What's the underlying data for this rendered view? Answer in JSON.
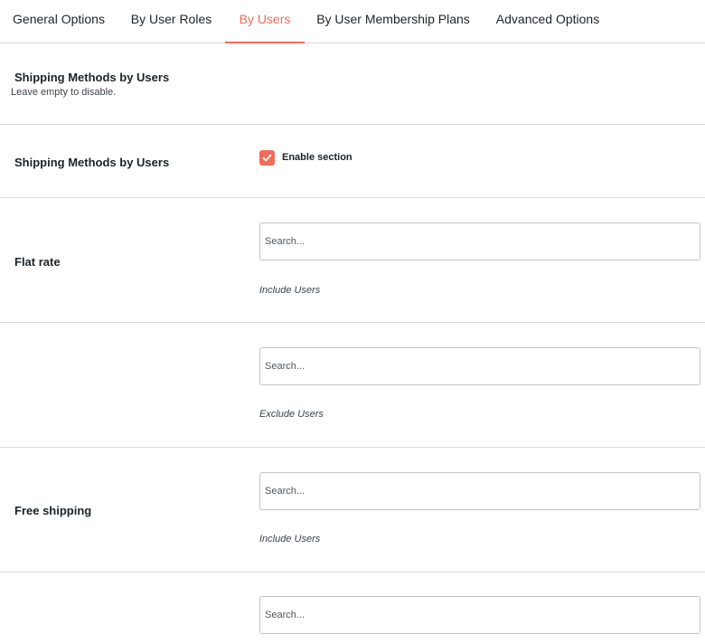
{
  "tabs": [
    {
      "label": "General Options",
      "active": false
    },
    {
      "label": "By User Roles",
      "active": false
    },
    {
      "label": "By Users",
      "active": true
    },
    {
      "label": "By User Membership Plans",
      "active": false
    },
    {
      "label": "Advanced Options",
      "active": false
    }
  ],
  "accent_color": "#f16b5b",
  "section": {
    "title": "Shipping Methods by Users",
    "description": "Leave empty to disable."
  },
  "enable_row": {
    "label": "Shipping Methods by Users",
    "checkbox_label": "Enable section",
    "checked": true
  },
  "methods": [
    {
      "label": "Flat rate",
      "include": {
        "placeholder": "Search...",
        "value": "",
        "hint": "Include Users"
      },
      "exclude": {
        "placeholder": "Search...",
        "value": "",
        "hint": "Exclude Users"
      }
    },
    {
      "label": "Free shipping",
      "include": {
        "placeholder": "Search...",
        "value": "",
        "hint": "Include Users"
      },
      "exclude": {
        "placeholder": "Search...",
        "value": ""
      }
    }
  ]
}
